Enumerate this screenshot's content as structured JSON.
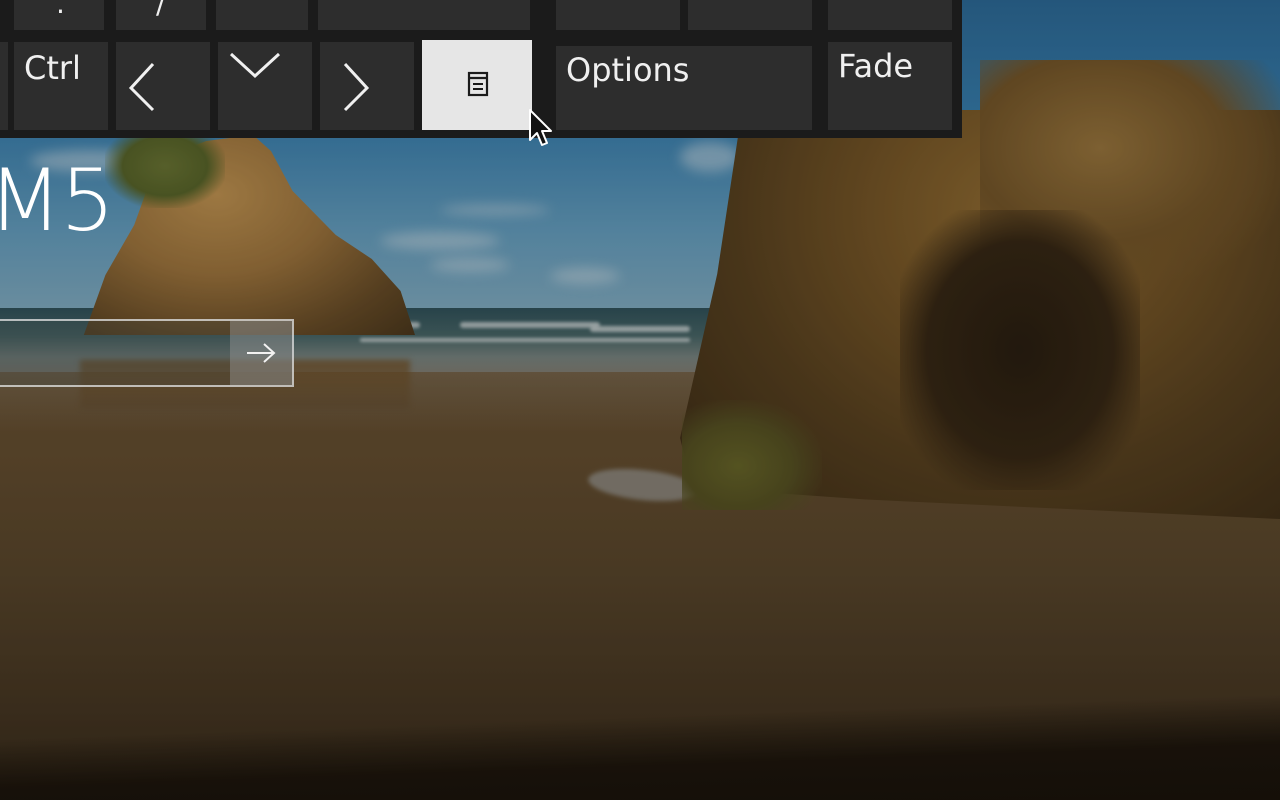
{
  "lock_screen": {
    "clock_partial": "M5",
    "password_placeholder": "",
    "submit_icon": "arrow-right-icon"
  },
  "osk": {
    "top_row_keys": [
      ".",
      "/",
      "",
      "",
      "",
      "",
      ""
    ],
    "bottom_row": {
      "ctrl_label": "Ctrl",
      "left_arrow_icon": "chevron-left-icon",
      "down_arrow_icon": "chevron-down-icon",
      "right_arrow_icon": "chevron-right-icon",
      "menu_key_icon": "context-menu-icon",
      "options_label": "Options",
      "fade_label": "Fade"
    },
    "pressed_key": "context-menu-key"
  }
}
